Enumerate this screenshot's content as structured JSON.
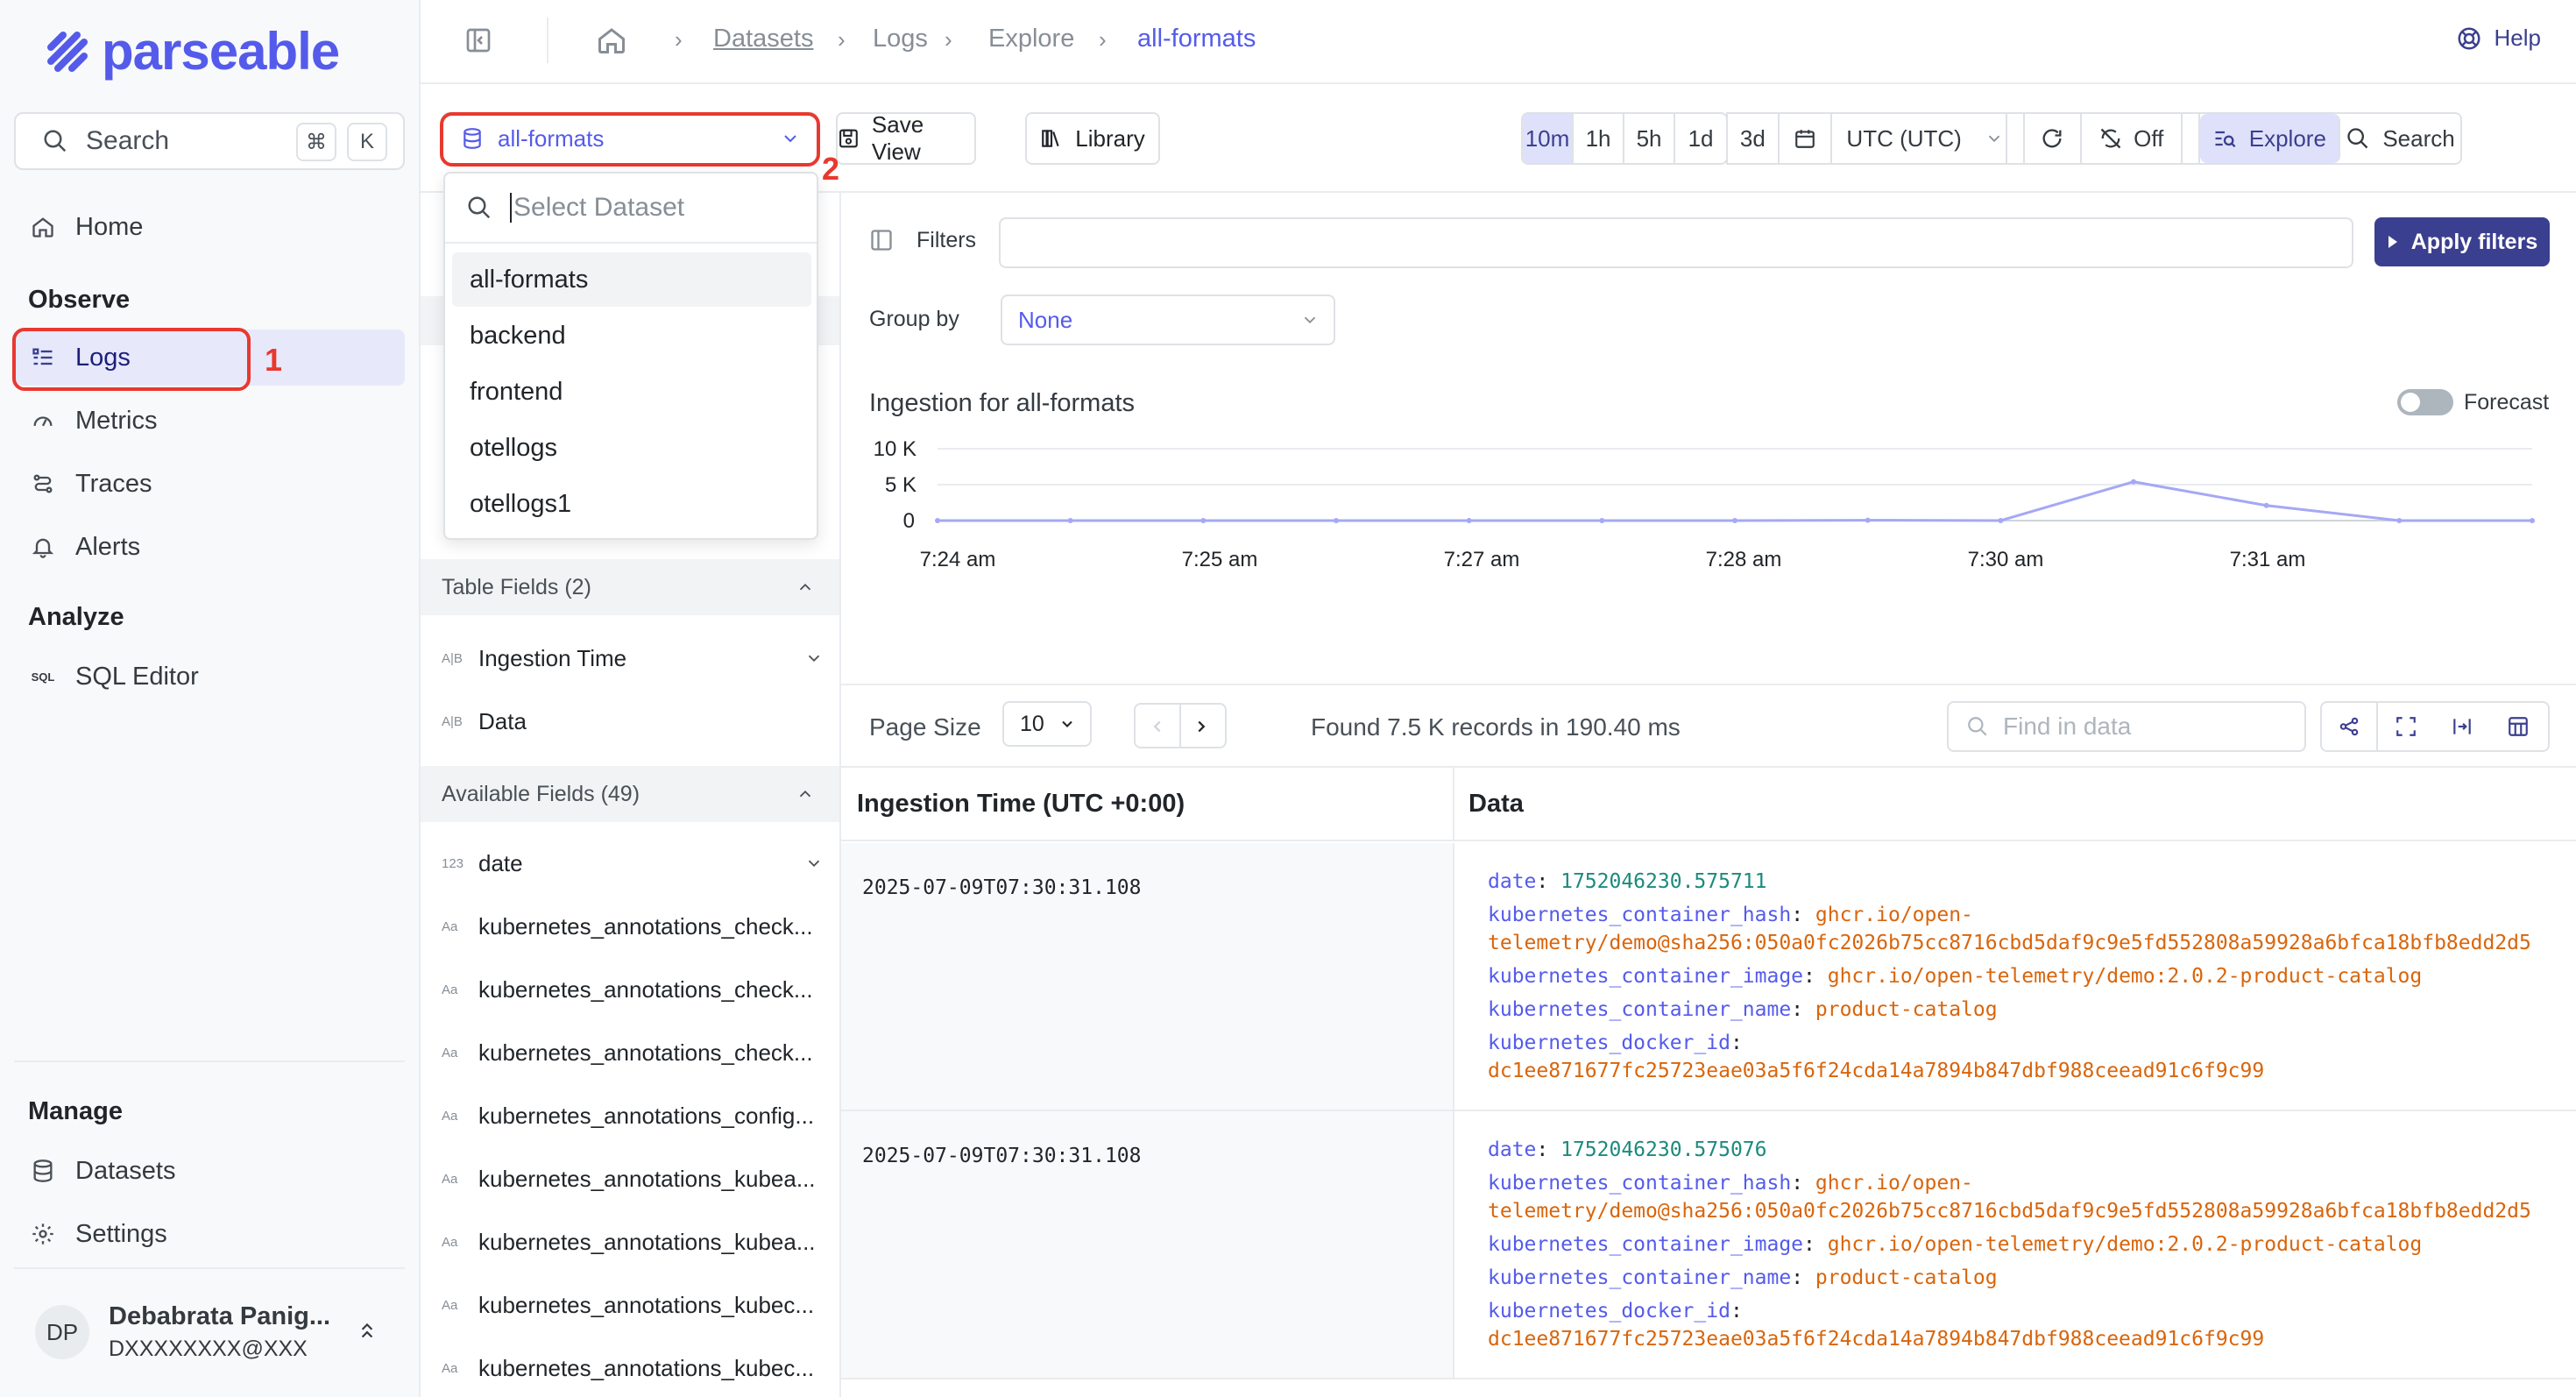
{
  "app": {
    "name": "parseable"
  },
  "sidebar": {
    "search_label": "Search",
    "shortcut_keys": [
      "⌘",
      "K"
    ],
    "home_label": "Home",
    "observe_title": "Observe",
    "items_observe": [
      {
        "label": "Logs",
        "icon": "logs-icon",
        "active": true
      },
      {
        "label": "Metrics",
        "icon": "gauge-icon",
        "active": false
      },
      {
        "label": "Traces",
        "icon": "traces-icon",
        "active": false
      },
      {
        "label": "Alerts",
        "icon": "bell-icon",
        "active": false
      }
    ],
    "analyze_title": "Analyze",
    "sql_editor_label": "SQL Editor",
    "sql_icon_text": "SQL",
    "manage_title": "Manage",
    "datasets_label": "Datasets",
    "settings_label": "Settings",
    "user": {
      "initials": "DP",
      "name": "Debabrata Panig...",
      "email": "DXXXXXXXX@XXX"
    }
  },
  "annotations": {
    "first": "1",
    "second": "2"
  },
  "breadcrumb": {
    "items": [
      "Datasets",
      "Logs",
      "Explore",
      "all-formats"
    ]
  },
  "header": {
    "help_label": "Help"
  },
  "toolbar": {
    "dataset_selected": "all-formats",
    "save_view_label": "Save View",
    "library_label": "Library",
    "time_ranges": [
      "10m",
      "1h",
      "5h",
      "1d",
      "3d"
    ],
    "active_time_range": "10m",
    "timezone": "UTC (UTC)",
    "refresh_label": "Off",
    "explore_label": "Explore",
    "search_label": "Search"
  },
  "dataset_dropdown": {
    "placeholder": "Select Dataset",
    "options": [
      "all-formats",
      "backend",
      "frontend",
      "otellogs",
      "otellogs1"
    ],
    "selected": "all-formats"
  },
  "fields_panel": {
    "table_fields_header": "Table Fields (2)",
    "table_fields": [
      {
        "type": "A|B",
        "name": "Ingestion Time"
      },
      {
        "type": "A|B",
        "name": "Data"
      }
    ],
    "available_header": "Available Fields (49)",
    "available_fields": [
      {
        "type": "123",
        "name": "date"
      },
      {
        "type": "Aa",
        "name": "kubernetes_annotations_check..."
      },
      {
        "type": "Aa",
        "name": "kubernetes_annotations_check..."
      },
      {
        "type": "Aa",
        "name": "kubernetes_annotations_check..."
      },
      {
        "type": "Aa",
        "name": "kubernetes_annotations_config..."
      },
      {
        "type": "Aa",
        "name": "kubernetes_annotations_kubea..."
      },
      {
        "type": "Aa",
        "name": "kubernetes_annotations_kubea..."
      },
      {
        "type": "Aa",
        "name": "kubernetes_annotations_kubec..."
      },
      {
        "type": "Aa",
        "name": "kubernetes_annotations_kubec..."
      }
    ]
  },
  "filters": {
    "filters_label": "Filters",
    "apply_label": "Apply filters",
    "group_by_label": "Group by",
    "group_by_value": "None"
  },
  "chart_data": {
    "type": "line",
    "title": "Ingestion for all-formats",
    "forecast_label": "Forecast",
    "y_ticks": [
      "10 K",
      "5 K",
      "0"
    ],
    "ylim": [
      0,
      10000
    ],
    "x_labels": [
      "7:24 am",
      "7:25 am",
      "7:27 am",
      "7:28 am",
      "7:30 am",
      "7:31 am"
    ],
    "series": [
      {
        "values": [
          0,
          0,
          0,
          0,
          0,
          0,
          0,
          50,
          0,
          5400,
          2100,
          0,
          0
        ]
      }
    ],
    "color": "#a5a8f5",
    "grid": true
  },
  "pagination": {
    "page_size_label": "Page Size",
    "page_size": "10",
    "found_text": "Found 7.5 K records in 190.40 ms",
    "find_placeholder": "Find in data"
  },
  "table": {
    "columns": [
      "Ingestion Time (UTC +0:00)",
      "Data"
    ],
    "rows": [
      {
        "time": "2025-07-09T07:30:31.108",
        "date_key": "date",
        "date": "1752046230.575711",
        "hash_key": "kubernetes_container_hash",
        "hash_1": "ghcr.io/open-",
        "hash_2": "telemetry/demo@sha256:050a0fc2026b75cc8716cbd5daf9c9e5fd552808a59928a6bfca18bfb8edd2d5",
        "image_key": "kubernetes_container_image",
        "image": "ghcr.io/open-telemetry/demo:2.0.2-product-catalog",
        "name_key": "kubernetes_container_name",
        "name": "product-catalog",
        "docker_key": "kubernetes_docker_id",
        "docker": "dc1ee871677fc25723eae03a5f6f24cda14a7894b847dbf988ceead91c6f9c99"
      },
      {
        "time": "2025-07-09T07:30:31.108",
        "date_key": "date",
        "date": "1752046230.575076",
        "hash_key": "kubernetes_container_hash",
        "hash_1": "ghcr.io/open-",
        "hash_2": "telemetry/demo@sha256:050a0fc2026b75cc8716cbd5daf9c9e5fd552808a59928a6bfca18bfb8edd2d5",
        "image_key": "kubernetes_container_image",
        "image": "ghcr.io/open-telemetry/demo:2.0.2-product-catalog",
        "name_key": "kubernetes_container_name",
        "name": "product-catalog",
        "docker_key": "kubernetes_docker_id",
        "docker": "dc1ee871677fc25723eae03a5f6f24cda14a7894b847dbf988ceead91c6f9c99"
      }
    ]
  }
}
